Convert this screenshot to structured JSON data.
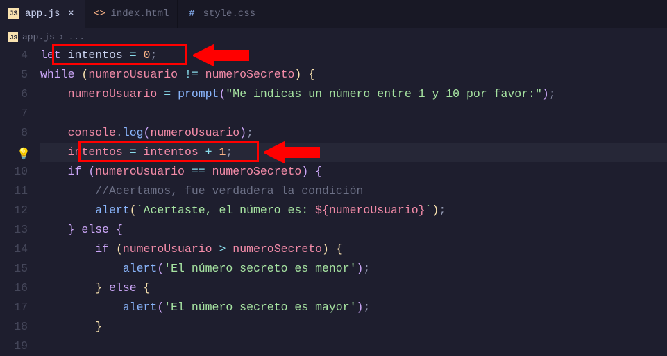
{
  "tabs": [
    {
      "icon": "js",
      "label": "app.js",
      "active": true,
      "closeable": true
    },
    {
      "icon": "html",
      "label": "index.html",
      "active": false,
      "closeable": false
    },
    {
      "icon": "css",
      "label": "style.css",
      "active": false,
      "closeable": false
    }
  ],
  "breadcrumb": {
    "icon": "js",
    "file": "app.js",
    "separator": "›",
    "symbol": "..."
  },
  "line_numbers": [
    "4",
    "5",
    "6",
    "7",
    "8",
    "9",
    "10",
    "11",
    "12",
    "13",
    "14",
    "15",
    "16",
    "17",
    "18",
    "19"
  ],
  "active_line_index": 5,
  "close_glyph": "×",
  "code": {
    "l4": {
      "let": "let",
      "sp": " ",
      "id": "intentos",
      "eq": " = ",
      "num": "0",
      "semi": ";"
    },
    "l5": {
      "while": "while",
      "sp": " ",
      "op": "(",
      "a": "numeroUsuario",
      "neq": " != ",
      "b": "numeroSecreto",
      "cp": ")",
      "sp2": " ",
      "ob": "{"
    },
    "l6": {
      "indent": "    ",
      "a": "numeroUsuario",
      "eq": " = ",
      "fn": "prompt",
      "op": "(",
      "str": "\"Me indicas un número entre 1 y 10 por favor:\"",
      "cp": ")",
      "semi": ";"
    },
    "l7": {
      "blank": ""
    },
    "l8": {
      "indent": "    ",
      "obj": "console",
      "dot": ".",
      "fn": "log",
      "op": "(",
      "a": "numeroUsuario",
      "cp": ")",
      "semi": ";"
    },
    "l9": {
      "indent": "    ",
      "a": "intentos",
      "eq": " = ",
      "b": "intentos",
      "plus": " + ",
      "num": "1",
      "semi": ";"
    },
    "l10": {
      "indent": "    ",
      "if": "if",
      "sp": " ",
      "op": "(",
      "a": "numeroUsuario",
      "cmp": " == ",
      "b": "numeroSecreto",
      "cp": ")",
      "sp2": " ",
      "ob": "{"
    },
    "l11": {
      "indent": "        ",
      "cmt": "//Acertamos, fue verdadera la condición"
    },
    "l12": {
      "indent": "        ",
      "fn": "alert",
      "op": "(",
      "bt": "`",
      "s1": "Acertaste, el número es: ",
      "io": "${",
      "v": "numeroUsuario",
      "ic": "}",
      "bt2": "`",
      "cp": ")",
      "semi": ";"
    },
    "l13": {
      "indent": "    ",
      "cb": "}",
      "sp": " ",
      "else": "else",
      "sp2": " ",
      "ob": "{"
    },
    "l14": {
      "indent": "        ",
      "if": "if",
      "sp": " ",
      "op": "(",
      "a": "numeroUsuario",
      "cmp": " > ",
      "b": "numeroSecreto",
      "cp": ")",
      "sp2": " ",
      "ob": "{"
    },
    "l15": {
      "indent": "            ",
      "fn": "alert",
      "op": "(",
      "str": "'El número secreto es menor'",
      "cp": ")",
      "semi": ";"
    },
    "l16": {
      "indent": "        ",
      "cb": "}",
      "sp": " ",
      "else": "else",
      "sp2": " ",
      "ob": "{"
    },
    "l17": {
      "indent": "            ",
      "fn": "alert",
      "op": "(",
      "str": "'El número secreto es mayor'",
      "cp": ")",
      "semi": ";"
    },
    "l18": {
      "indent": "        ",
      "cb": "}"
    },
    "l19": {
      "blank": ""
    }
  },
  "annotations": {
    "lightbulb": "💡"
  }
}
